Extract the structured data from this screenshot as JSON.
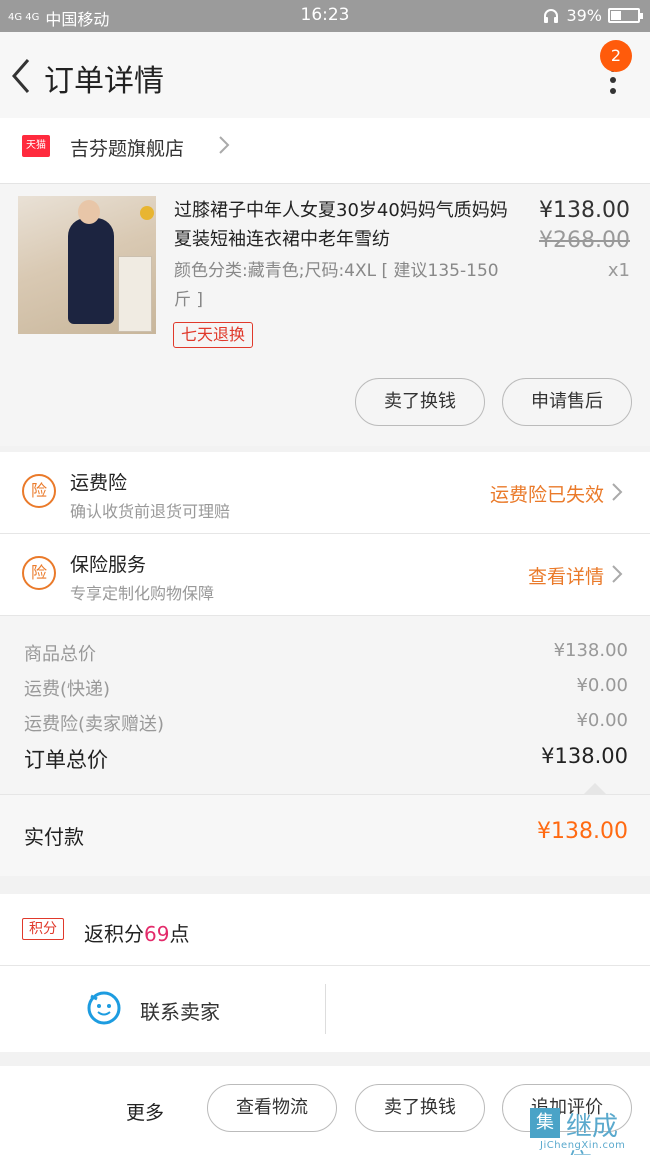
{
  "status_bar": {
    "network": "4G 4G",
    "carrier": "中国移动",
    "time": "16:23",
    "battery": "39%"
  },
  "header": {
    "title": "订单详情",
    "badge_count": "2"
  },
  "shop": {
    "tmall_badge": "天猫",
    "name": "吉芬题旗舰店"
  },
  "product": {
    "title": "过膝裙子中年人女夏30岁40妈妈气质妈妈夏装短袖连衣裙中老年雪纺",
    "spec": "颜色分类:藏青色;尺码:4XL [ 建议135-150斤 ]",
    "price": "¥138.00",
    "original_price": "¥268.00",
    "quantity": "x1",
    "return_tag": "七天退换",
    "btn_refund": "卖了换钱",
    "btn_after_sale": "申请售后"
  },
  "insurance": [
    {
      "icon": "险",
      "title": "运费险",
      "subtitle": "确认收货前退货可理赔",
      "status": "运费险已失效"
    },
    {
      "icon": "险",
      "title": "保险服务",
      "subtitle": "专享定制化购物保障",
      "status": "查看详情"
    }
  ],
  "summary": {
    "rows": [
      {
        "label": "商品总价",
        "value": "¥138.00"
      },
      {
        "label": "运费(快递)",
        "value": "¥0.00"
      },
      {
        "label": "运费险(卖家赠送)",
        "value": "¥0.00"
      }
    ],
    "total_label": "订单总价",
    "total_value": "¥138.00",
    "paid_label": "实付款",
    "paid_value": "¥138.00"
  },
  "points": {
    "tag": "积分",
    "text_prefix": "返积分",
    "count": "69",
    "text_suffix": "点"
  },
  "contact": {
    "label": "联系卖家"
  },
  "footer": {
    "more_label": "更多",
    "btn_logistics": "查看物流",
    "btn_sell": "卖了换钱",
    "btn_review": "追加评价"
  },
  "watermark": {
    "cn": "继成信",
    "en": "JiChengXin.com"
  },
  "colors": {
    "accent": "#ff6a12",
    "status_orange": "#ea7a2a",
    "tmall_red": "#ff2a3d",
    "points_pink": "#e32a6a"
  }
}
